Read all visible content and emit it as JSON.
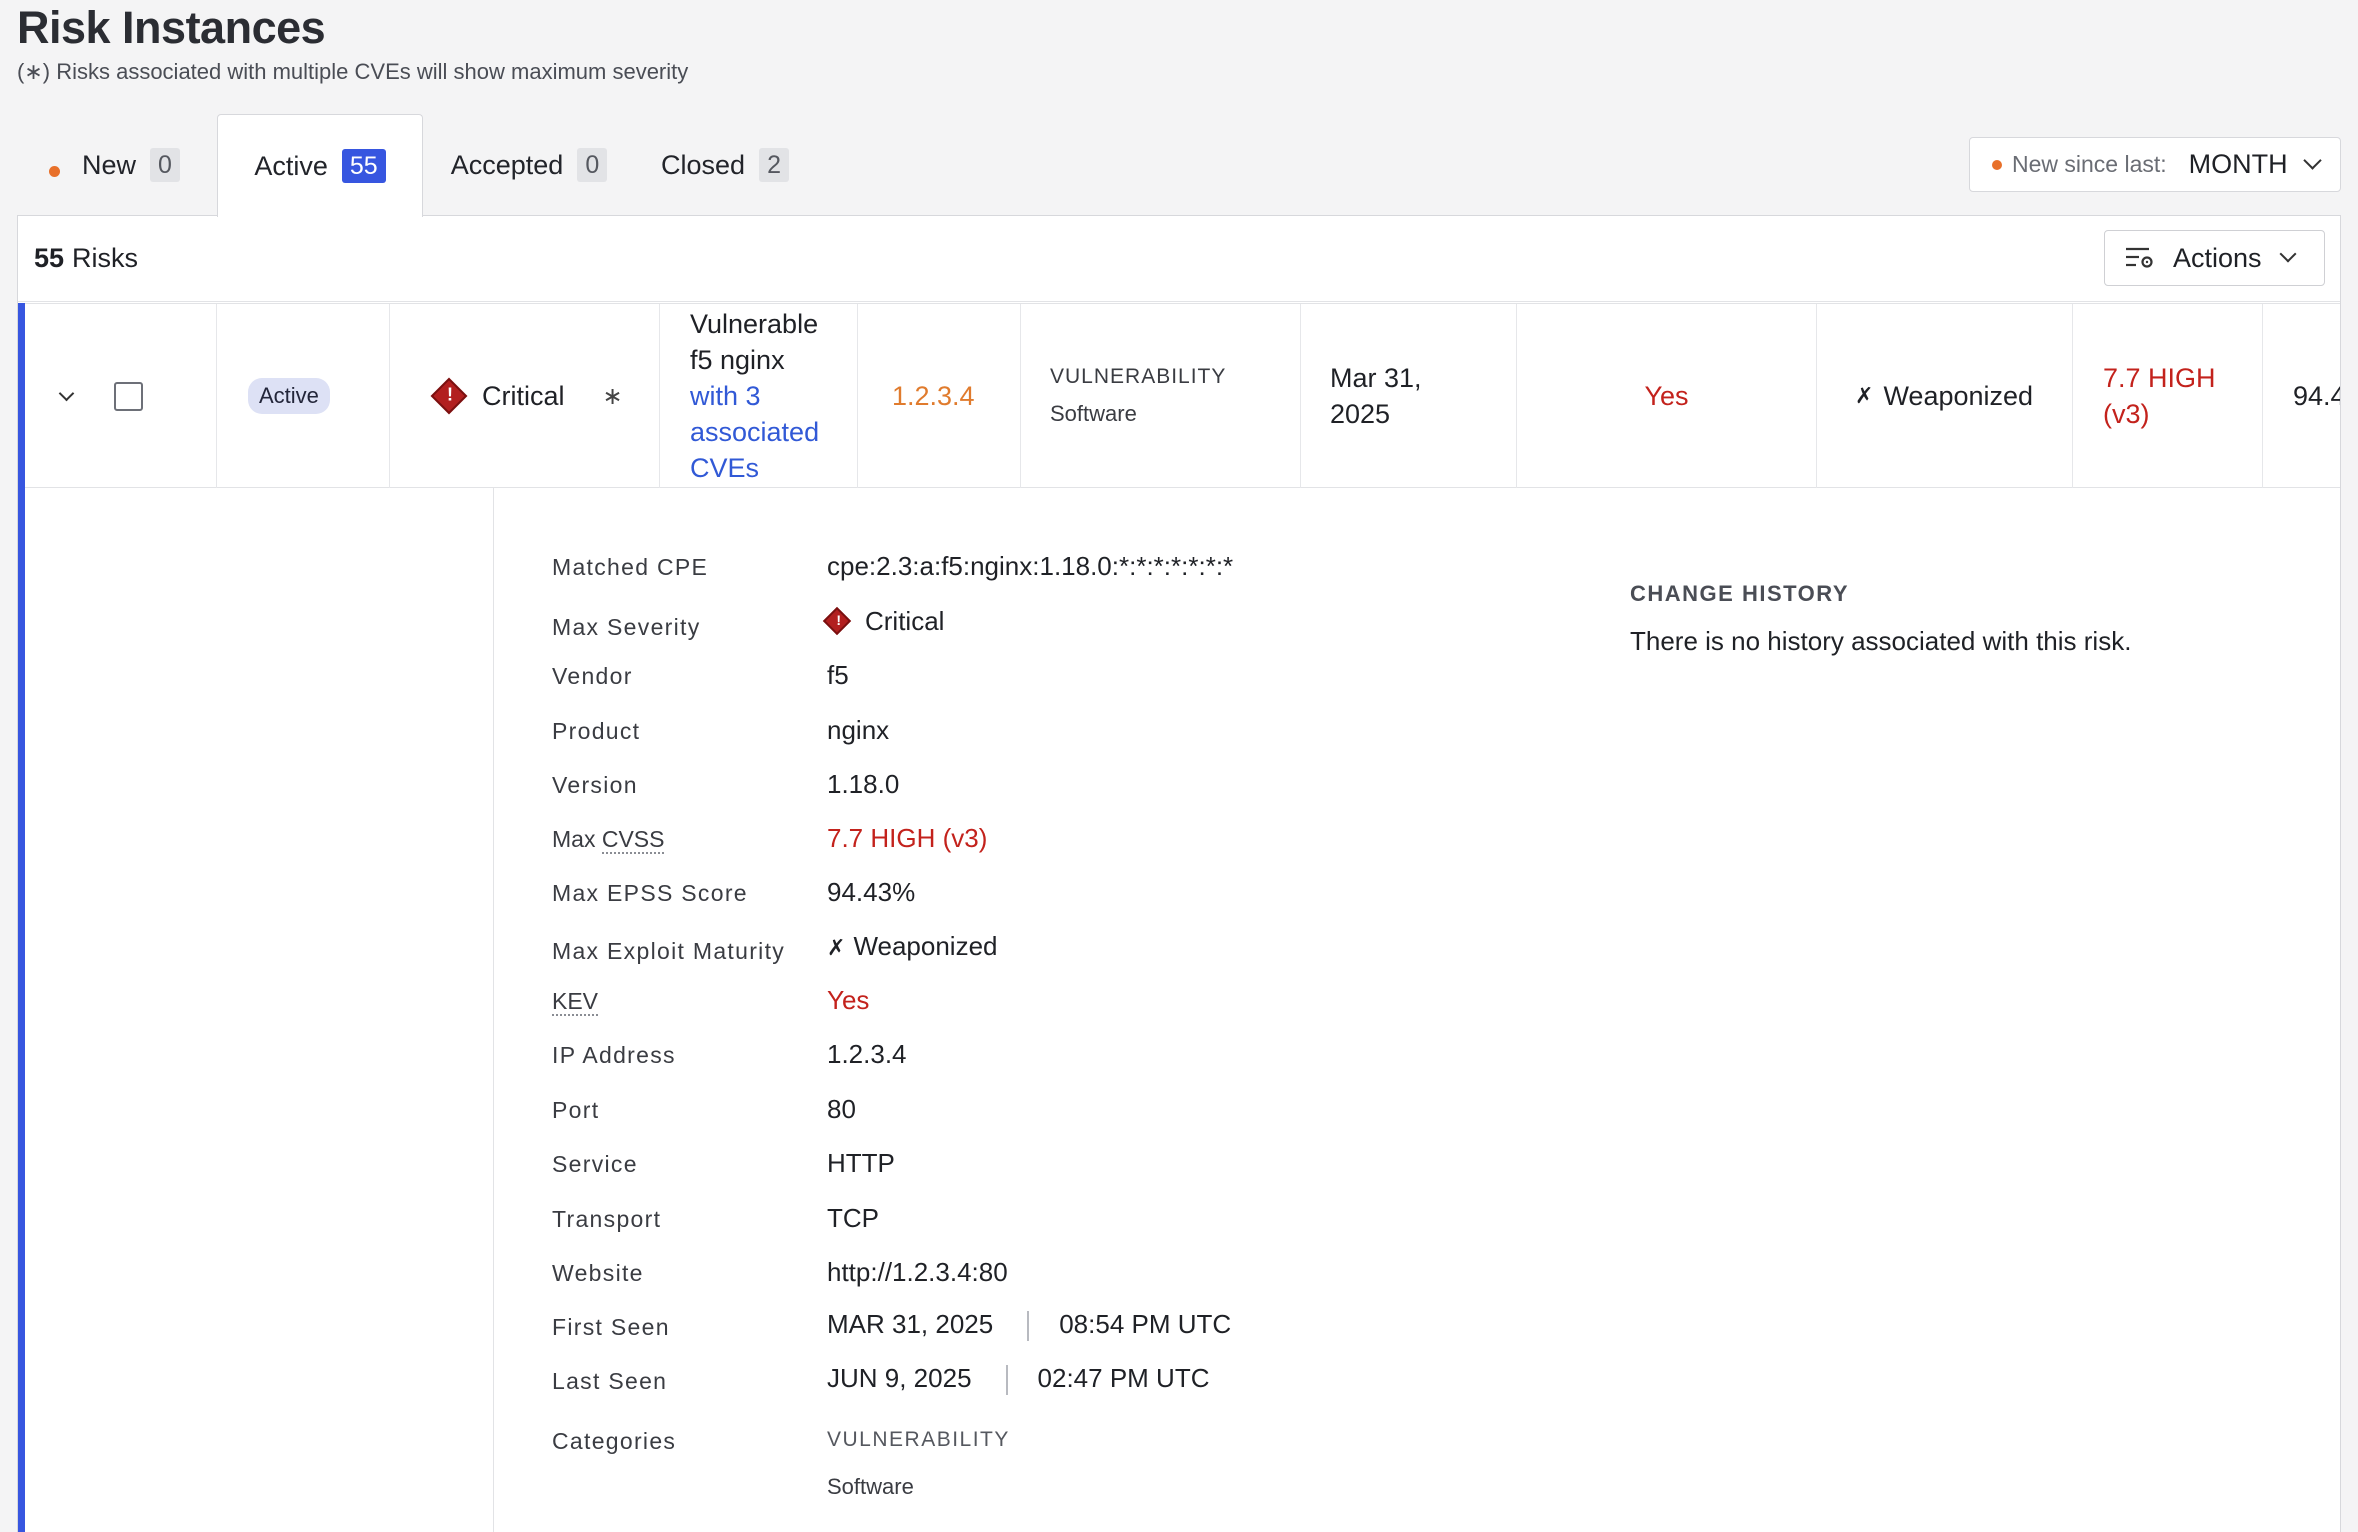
{
  "page": {
    "title": "Risk Instances",
    "subtitle": "(∗) Risks associated with multiple CVEs will show maximum severity"
  },
  "tabs": [
    {
      "label": "New",
      "count": "0"
    },
    {
      "label": "Active",
      "count": "55"
    },
    {
      "label": "Accepted",
      "count": "0"
    },
    {
      "label": "Closed",
      "count": "2"
    }
  ],
  "since_filter": {
    "label": "New since last:",
    "value": "MONTH"
  },
  "summary": {
    "count": "55",
    "label": "Risks"
  },
  "actions": {
    "label": "Actions"
  },
  "row": {
    "status": "Active",
    "severity": "Critical",
    "severity_marker": "∗",
    "name_line1": "Vulnerable",
    "name_line2": "f5 nginx",
    "name_link1": "with 3",
    "name_link2": "associated",
    "name_link3": "CVEs",
    "ip": "1.2.3.4",
    "category": "VULNERABILITY",
    "subcategory": "Software",
    "date_line1": "Mar 31,",
    "date_line2": "2025",
    "kev": "Yes",
    "exploit": "Weaponized",
    "cvss_line1": "7.7 HIGH",
    "cvss_line2": "(v3)",
    "epss_partial": "94.4"
  },
  "details": {
    "matched_cpe": {
      "label": "Matched CPE",
      "value": "cpe:2.3:a:f5:nginx:1.18.0:*:*:*:*:*:*:*"
    },
    "max_severity": {
      "label": "Max Severity",
      "value": "Critical"
    },
    "vendor": {
      "label": "Vendor",
      "value": "f5"
    },
    "product": {
      "label": "Product",
      "value": "nginx"
    },
    "version": {
      "label": "Version",
      "value": "1.18.0"
    },
    "max_cvss": {
      "label_prefix": "Max ",
      "label_abbr": "CVSS",
      "value": "7.7 HIGH (v3)"
    },
    "max_epss": {
      "label": "Max EPSS Score",
      "value": "94.43%"
    },
    "max_exploit": {
      "label": "Max Exploit Maturity",
      "value": "Weaponized"
    },
    "kev": {
      "label": "KEV",
      "value": "Yes"
    },
    "ip": {
      "label": "IP Address",
      "value": "1.2.3.4"
    },
    "port": {
      "label": "Port",
      "value": "80"
    },
    "service": {
      "label": "Service",
      "value": "HTTP"
    },
    "transport": {
      "label": "Transport",
      "value": "TCP"
    },
    "website": {
      "label": "Website",
      "value": "http://1.2.3.4:80"
    },
    "first_seen": {
      "label": "First Seen",
      "date": "MAR 31, 2025",
      "time": "08:54 PM UTC"
    },
    "last_seen": {
      "label": "Last Seen",
      "date": "JUN 9, 2025",
      "time": "02:47 PM UTC"
    },
    "categories": {
      "label": "Categories",
      "category": "VULNERABILITY",
      "subcategory": "Software"
    }
  },
  "history": {
    "title": "CHANGE HISTORY",
    "text": "There is no history associated with this risk."
  },
  "colors": {
    "accent": "#3756e0",
    "critical": "#b21f1f",
    "danger_text": "#c3221c",
    "ip_orange": "#e07b2d",
    "new_dot": "#e8702a"
  }
}
